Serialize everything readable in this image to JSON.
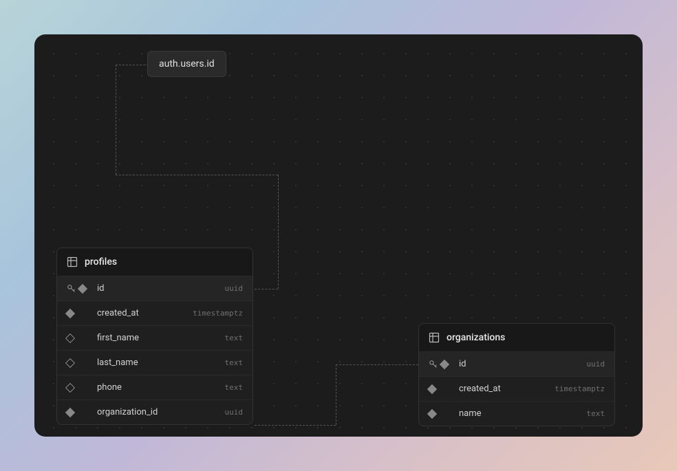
{
  "reference": {
    "label": "auth.users.id"
  },
  "tables": {
    "profiles": {
      "name": "profiles",
      "columns": [
        {
          "name": "id",
          "type": "uuid",
          "pk": true,
          "fk": true,
          "nullable": false
        },
        {
          "name": "created_at",
          "type": "timestamptz",
          "pk": false,
          "fk": false,
          "nullable": false
        },
        {
          "name": "first_name",
          "type": "text",
          "pk": false,
          "fk": false,
          "nullable": true
        },
        {
          "name": "last_name",
          "type": "text",
          "pk": false,
          "fk": false,
          "nullable": true
        },
        {
          "name": "phone",
          "type": "text",
          "pk": false,
          "fk": false,
          "nullable": true
        },
        {
          "name": "organization_id",
          "type": "uuid",
          "pk": false,
          "fk": false,
          "nullable": false
        }
      ]
    },
    "organizations": {
      "name": "organizations",
      "columns": [
        {
          "name": "id",
          "type": "uuid",
          "pk": true,
          "fk": true,
          "nullable": false
        },
        {
          "name": "created_at",
          "type": "timestamptz",
          "pk": false,
          "fk": false,
          "nullable": false
        },
        {
          "name": "name",
          "type": "text",
          "pk": false,
          "fk": false,
          "nullable": false
        }
      ]
    }
  }
}
